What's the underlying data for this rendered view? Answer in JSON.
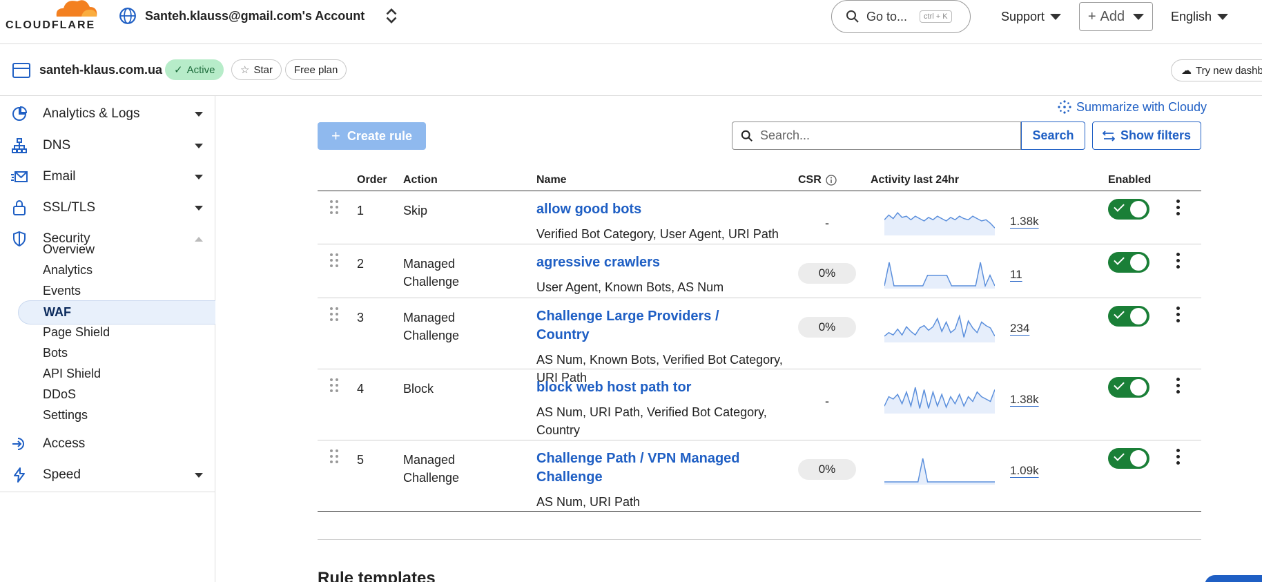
{
  "brand": {
    "name": "CLOUDFLARE"
  },
  "header": {
    "account": "Santeh.klauss@gmail.com's Account",
    "goto": {
      "label": "Go to...",
      "shortcut": "ctrl + K"
    },
    "support": "Support",
    "add": "Add",
    "language": "English"
  },
  "zone": {
    "name": "santeh-klaus.com.ua",
    "status": "Active",
    "star": "Star",
    "plan": "Free plan",
    "try_new": "Try new dashboard"
  },
  "sidebar": {
    "items": [
      {
        "label": "Analytics & Logs",
        "icon": "chart-icon"
      },
      {
        "label": "DNS",
        "icon": "network-icon"
      },
      {
        "label": "Email",
        "icon": "email-icon"
      },
      {
        "label": "SSL/TLS",
        "icon": "lock-icon"
      },
      {
        "label": "Security",
        "icon": "shield-icon"
      }
    ],
    "security_sub": [
      "Overview",
      "Analytics",
      "Events",
      "WAF",
      "Page Shield",
      "Bots",
      "API Shield",
      "DDoS",
      "Settings"
    ],
    "active_sub": "WAF",
    "after": [
      {
        "label": "Access",
        "icon": "access-icon"
      },
      {
        "label": "Speed",
        "icon": "bolt-icon"
      }
    ]
  },
  "toolbar": {
    "create_rule": "Create rule",
    "summarize": "Summarize with Cloudy",
    "search_placeholder": "Search...",
    "search_button": "Search",
    "show_filters": "Show filters"
  },
  "table": {
    "headers": {
      "order": "Order",
      "action": "Action",
      "name": "Name",
      "csr": "CSR",
      "activity": "Activity last 24hr",
      "enabled": "Enabled"
    },
    "rows": [
      {
        "order": "1",
        "action": "Skip",
        "name": "allow good bots",
        "fields": "Verified Bot Category, User Agent, URI Path",
        "csr": "-",
        "count": "1.38k",
        "enabled": true,
        "spark": [
          0.55,
          0.75,
          0.6,
          0.85,
          0.65,
          0.7,
          0.55,
          0.7,
          0.6,
          0.5,
          0.65,
          0.55,
          0.7,
          0.6,
          0.5,
          0.65,
          0.55,
          0.7,
          0.6,
          0.55,
          0.7,
          0.6,
          0.5,
          0.55,
          0.4,
          0.2
        ]
      },
      {
        "order": "2",
        "action": "Managed Challenge",
        "name": "agressive crawlers",
        "fields": "User Agent, Known Bots, AS Num",
        "csr": "0%",
        "count": "11",
        "enabled": true,
        "spark": [
          0,
          1,
          0,
          0,
          0,
          0,
          0,
          0,
          0,
          0.45,
          0.45,
          0.45,
          0.45,
          0.45,
          0,
          0,
          0,
          0,
          0,
          0,
          1,
          0,
          0.45,
          0
        ]
      },
      {
        "order": "3",
        "action": "Managed Challenge",
        "name": "Challenge Large Providers / Country",
        "fields": "AS Num, Known Bots, Verified Bot Category, URI Path",
        "csr": "0%",
        "count": "234",
        "enabled": true,
        "spark": [
          0.15,
          0.3,
          0.2,
          0.45,
          0.2,
          0.55,
          0.35,
          0.2,
          0.5,
          0.6,
          0.4,
          0.55,
          0.9,
          0.35,
          0.75,
          0.3,
          0.45,
          1,
          0.1,
          0.8,
          0.5,
          0.3,
          0.75,
          0.6,
          0.5,
          0.15
        ]
      },
      {
        "order": "4",
        "action": "Block",
        "name": "block web host path tor",
        "fields": "AS Num, URI Path, Verified Bot Category, Country",
        "csr": "-",
        "count": "1.38k",
        "enabled": true,
        "spark": [
          0.2,
          0.6,
          0.5,
          0.7,
          0.3,
          0.8,
          0.2,
          1,
          0.1,
          0.9,
          0.1,
          0.8,
          0.2,
          0.7,
          0.15,
          0.6,
          0.3,
          0.7,
          0.2,
          0.6,
          0.4,
          0.8,
          0.6,
          0.5,
          0.4,
          0.9
        ]
      },
      {
        "order": "5",
        "action": "Managed Challenge",
        "name": "Challenge Path / VPN Managed Challenge",
        "fields": "AS Num, URI Path",
        "csr": "0%",
        "count": "1.09k",
        "enabled": true,
        "spark": [
          0,
          0,
          0,
          0,
          0,
          0,
          0,
          0,
          1,
          0,
          0,
          0,
          0,
          0,
          0,
          0,
          0,
          0,
          0,
          0,
          0,
          0,
          0,
          0
        ]
      }
    ]
  },
  "section": {
    "templates": "Rule templates"
  },
  "colors": {
    "accent": "#1f5fc4",
    "toggle_on": "#1a7f37",
    "brand_orange": "#f38020"
  }
}
